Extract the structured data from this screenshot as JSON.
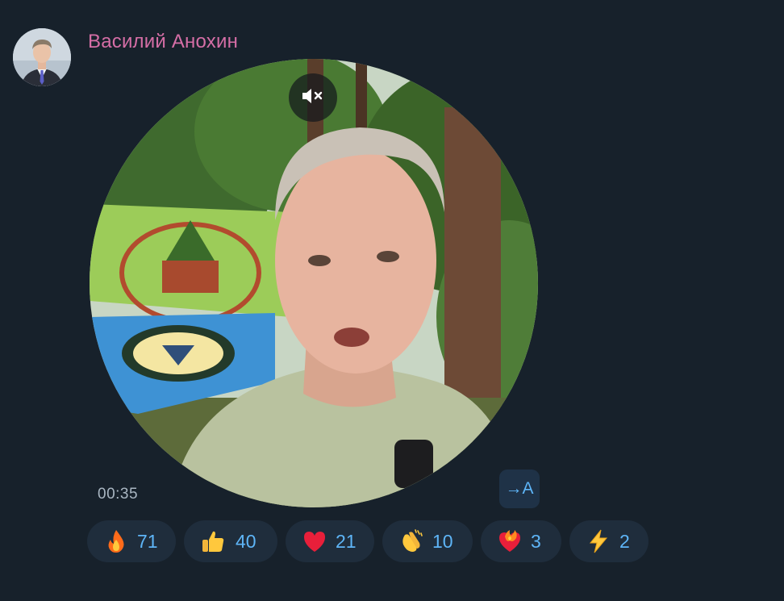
{
  "message": {
    "sender_name": "Василий Анохин",
    "duration": "00:35",
    "translate_label": "→A",
    "mute_icon": "speaker-muted-icon",
    "colors": {
      "background": "#17212b",
      "sender_name": "#d56ea6",
      "reaction_count": "#5eb5f7",
      "reaction_bg": "#1f2d3c"
    }
  },
  "reactions": [
    {
      "emoji": "fire",
      "count": "71"
    },
    {
      "emoji": "thumbs-up",
      "count": "40"
    },
    {
      "emoji": "red-heart",
      "count": "21"
    },
    {
      "emoji": "clapping-hands",
      "count": "10"
    },
    {
      "emoji": "heart-on-fire",
      "count": "3"
    },
    {
      "emoji": "high-voltage",
      "count": "2"
    }
  ]
}
